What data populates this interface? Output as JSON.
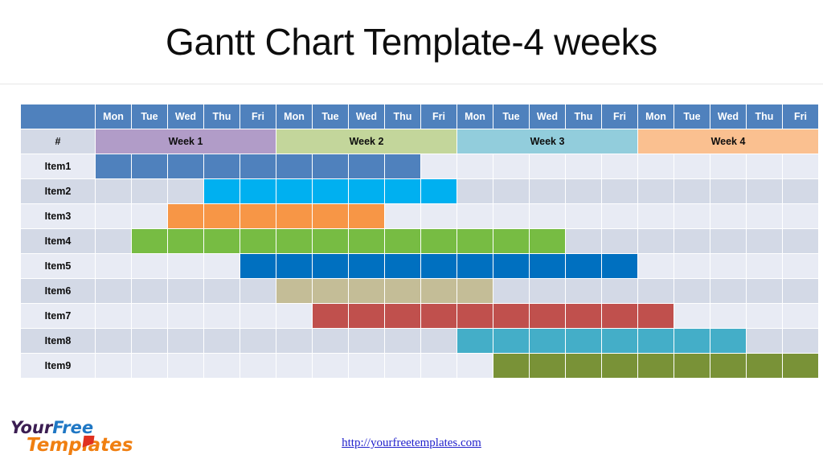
{
  "page_title": "Gantt Chart Template-4 weeks",
  "table": {
    "corner_label": "",
    "row_number_label": "#",
    "day_headers": [
      "Mon",
      "Tue",
      "Wed",
      "Thu",
      "Fri",
      "Mon",
      "Tue",
      "Wed",
      "Thu",
      "Fri",
      "Mon",
      "Tue",
      "Wed",
      "Thu",
      "Fri",
      "Mon",
      "Tue",
      "Wed",
      "Thu",
      "Fri"
    ],
    "weeks": [
      {
        "label": "Week 1",
        "span": 5,
        "color": "#B19CC8"
      },
      {
        "label": "Week 2",
        "span": 5,
        "color": "#C3D69B"
      },
      {
        "label": "Week 3",
        "span": 5,
        "color": "#92CDDC"
      },
      {
        "label": "Week 4",
        "span": 5,
        "color": "#FAC090"
      }
    ],
    "columns": 20
  },
  "chart_data": {
    "type": "bar",
    "title": "Gantt Chart Template-4 weeks",
    "xlabel": "",
    "ylabel": "",
    "categories": [
      "Item1",
      "Item2",
      "Item3",
      "Item4",
      "Item5",
      "Item6",
      "Item7",
      "Item8",
      "Item9"
    ],
    "x": [
      "Mon",
      "Tue",
      "Wed",
      "Thu",
      "Fri",
      "Mon",
      "Tue",
      "Wed",
      "Thu",
      "Fri",
      "Mon",
      "Tue",
      "Wed",
      "Thu",
      "Fri",
      "Mon",
      "Tue",
      "Wed",
      "Thu",
      "Fri"
    ],
    "xlim": [
      1,
      20
    ],
    "grid": true,
    "legend": "none",
    "tasks": [
      {
        "name": "Item1",
        "start": 1,
        "end": 9,
        "duration": 9,
        "color": "#4F81BD"
      },
      {
        "name": "Item2",
        "start": 4,
        "end": 10,
        "duration": 7,
        "color": "#00B0F0"
      },
      {
        "name": "Item3",
        "start": 3,
        "end": 8,
        "duration": 6,
        "color": "#F79646"
      },
      {
        "name": "Item4",
        "start": 2,
        "end": 13,
        "duration": 12,
        "color": "#77BC43"
      },
      {
        "name": "Item5",
        "start": 5,
        "end": 15,
        "duration": 11,
        "color": "#0070C0"
      },
      {
        "name": "Item6",
        "start": 6,
        "end": 11,
        "duration": 6,
        "color": "#C4BD97"
      },
      {
        "name": "Item7",
        "start": 7,
        "end": 16,
        "duration": 10,
        "color": "#C0504D"
      },
      {
        "name": "Item8",
        "start": 11,
        "end": 18,
        "duration": 8,
        "color": "#44AEC8"
      },
      {
        "name": "Item9",
        "start": 12,
        "end": 20,
        "duration": 9,
        "color": "#799237"
      }
    ]
  },
  "footer": {
    "logo_your": "Your",
    "logo_free": "Free",
    "logo_templates": "Templates",
    "url": "http://yourfreetemplates.com"
  }
}
